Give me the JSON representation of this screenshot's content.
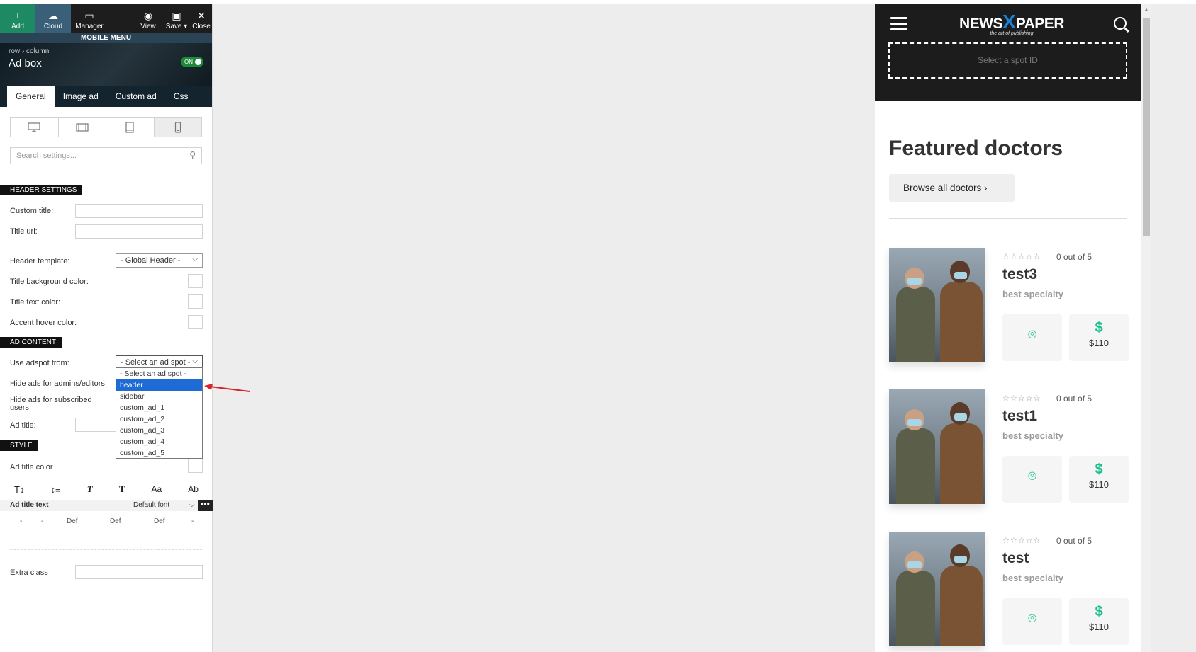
{
  "toolbar": {
    "add": "Add",
    "cloud": "Cloud",
    "manager": "Manager",
    "view": "View",
    "save": "Save",
    "close": "Close"
  },
  "mode_label": "MOBILE MENU",
  "hero": {
    "breadcrumb_row": "row",
    "breadcrumb_column": "column",
    "title": "Ad box",
    "toggle": "ON"
  },
  "tabs": [
    "General",
    "Image ad",
    "Custom ad",
    "Css"
  ],
  "search_placeholder": "Search settings...",
  "header_settings": {
    "heading": "HEADER SETTINGS",
    "custom_title": "Custom title:",
    "title_url": "Title url:",
    "header_template": "Header template:",
    "header_template_value": "- Global Header -",
    "title_bg_color": "Title background color:",
    "title_text_color": "Title text color:",
    "accent_hover_color": "Accent hover color:"
  },
  "ad_content": {
    "heading": "AD CONTENT",
    "use_adspot": "Use adspot from:",
    "adspot_value": "- Select an ad spot -",
    "hide_admins": "Hide ads for admins/editors",
    "hide_subscribed_1": "Hide ads for subscribed",
    "hide_subscribed_2": "users",
    "ad_title": "Ad title:",
    "options": [
      "- Select an ad spot -",
      "header",
      "sidebar",
      "custom_ad_1",
      "custom_ad_2",
      "custom_ad_3",
      "custom_ad_4",
      "custom_ad_5"
    ],
    "highlighted_option": "header"
  },
  "style": {
    "heading": "STYLE",
    "ad_title_color": "Ad title color",
    "ad_title_text": "Ad title text",
    "default_font": "Default font",
    "icons": [
      "T↕",
      "↕≡",
      "T",
      "T",
      "Aa",
      "Ab"
    ],
    "size_values": [
      "-",
      "-",
      "Def",
      "Def",
      "Def",
      "-"
    ],
    "extra_class": "Extra class"
  },
  "preview": {
    "logo_left": "NEWS",
    "logo_x": "X",
    "logo_right": "PAPER",
    "tagline": "the art of publishing",
    "adspot_placeholder": "Select a spot ID",
    "featured_title": "Featured doctors",
    "browse_button": "Browse all doctors  ›",
    "doctors": [
      {
        "name": "test3",
        "rating": "0 out of 5",
        "specialty": "best specialty",
        "price": "$110"
      },
      {
        "name": "test1",
        "rating": "0 out of 5",
        "specialty": "best specialty",
        "price": "$110"
      },
      {
        "name": "test",
        "rating": "0 out of 5",
        "specialty": "best specialty",
        "price": "$110"
      }
    ]
  },
  "colors": {
    "add_button": "#1d8a63",
    "cloud_button": "#3a5f78",
    "accent_green": "#1bbf8f",
    "highlight_blue": "#1e6bd6",
    "annotation_arrow": "#d8232a"
  }
}
